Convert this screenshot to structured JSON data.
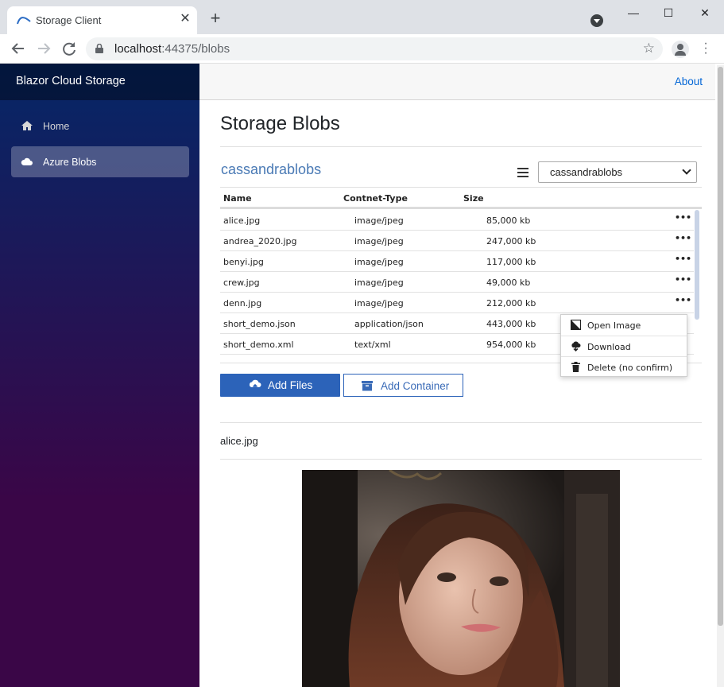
{
  "browser": {
    "tab_title": "Storage Client",
    "url_host": "localhost",
    "url_path": ":44375/blobs",
    "new_tab": "+",
    "minimize": "—",
    "maximize": "☐",
    "close": "✕"
  },
  "app": {
    "brand": "Blazor Cloud Storage",
    "about_link": "About",
    "nav": [
      {
        "label": "Home",
        "icon": "home-icon"
      },
      {
        "label": "Azure Blobs",
        "icon": "cloud-icon"
      }
    ]
  },
  "page": {
    "title": "Storage Blobs",
    "container_name": "cassandrablobs",
    "container_select": "cassandrablobs"
  },
  "table": {
    "headers": [
      "Name",
      "Contnet-Type",
      "Size"
    ],
    "rows": [
      {
        "name": "alice.jpg",
        "type": "image/jpeg",
        "size": "85,000 kb"
      },
      {
        "name": "andrea_2020.jpg",
        "type": "image/jpeg",
        "size": "247,000 kb"
      },
      {
        "name": "benyi.jpg",
        "type": "image/jpeg",
        "size": "117,000 kb"
      },
      {
        "name": "crew.jpg",
        "type": "image/jpeg",
        "size": "49,000 kb"
      },
      {
        "name": "denn.jpg",
        "type": "image/jpeg",
        "size": "212,000 kb"
      },
      {
        "name": "short_demo.json",
        "type": "application/json",
        "size": "443,000 kb"
      },
      {
        "name": "short_demo.xml",
        "type": "text/xml",
        "size": "954,000 kb"
      }
    ],
    "row_menu": "•••"
  },
  "context_menu": {
    "items": [
      {
        "label": "Open Image",
        "icon": "image-icon"
      },
      {
        "label": "Download",
        "icon": "cloud-download-icon"
      },
      {
        "label": "Delete (no confirm)",
        "icon": "trash-icon"
      }
    ]
  },
  "actions": {
    "add_files": "Add Files",
    "add_container": "Add Container"
  },
  "preview": {
    "file_name": "alice.jpg"
  },
  "colors": {
    "sidebar_top": "#052767",
    "sidebar_bottom": "#3a0647",
    "primary": "#2c63b9",
    "link": "#0366d6",
    "container_title": "#4a7ab5"
  }
}
